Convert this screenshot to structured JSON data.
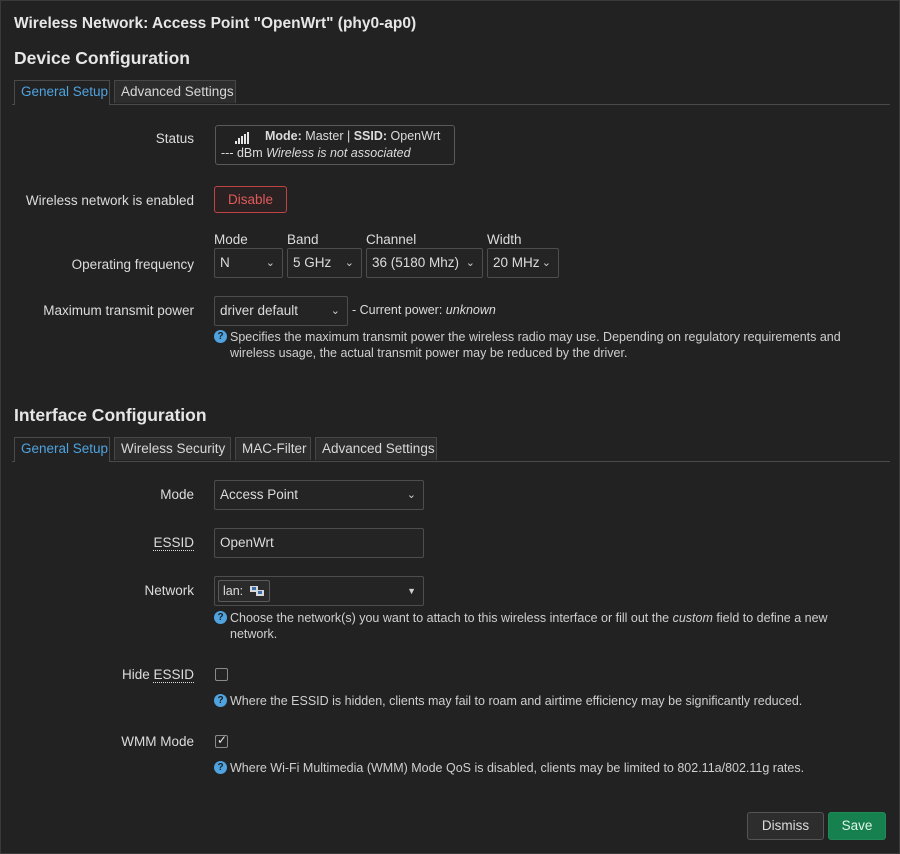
{
  "title": "Wireless Network: Access Point \"OpenWrt\" (phy0-ap0)",
  "device_section": {
    "heading": "Device Configuration",
    "tabs": [
      "General Setup",
      "Advanced Settings"
    ],
    "status_label": "Status",
    "status": {
      "mode_key": "Mode:",
      "mode_value": "Master",
      "separator": "|",
      "ssid_key": "SSID:",
      "ssid_value": "OpenWrt",
      "signal": "--- dBm",
      "association": "Wireless is not associated"
    },
    "enabled_label": "Wireless network is enabled",
    "disable_button": "Disable",
    "frequency_label": "Operating frequency",
    "mode_caption": "Mode",
    "mode_value": "N",
    "band_caption": "Band",
    "band_value": "5 GHz",
    "channel_caption": "Channel",
    "channel_value": "36 (5180 Mhz)",
    "width_caption": "Width",
    "width_value": "20 MHz",
    "txpower_label": "Maximum transmit power",
    "txpower_value": "driver default",
    "current_power_prefix": "- Current power:",
    "current_power_value": "unknown",
    "txpower_help": "Specifies the maximum transmit power the wireless radio may use. Depending on regulatory requirements and wireless usage, the actual transmit power may be reduced by the driver."
  },
  "interface_section": {
    "heading": "Interface Configuration",
    "tabs": [
      "General Setup",
      "Wireless Security",
      "MAC-Filter",
      "Advanced Settings"
    ],
    "mode_label": "Mode",
    "mode_value": "Access Point",
    "essid_label": "ESSID",
    "essid_value": "OpenWrt",
    "network_label": "Network",
    "network_chip": "lan:",
    "network_help_1": "Choose the network(s) you want to attach to this wireless interface or fill out the",
    "network_help_em": "custom",
    "network_help_2": "field to define a new network.",
    "hide_label_pre": "Hide",
    "hide_label_abbr": "ESSID",
    "hide_checked": false,
    "hide_help": "Where the ESSID is hidden, clients may fail to roam and airtime efficiency may be significantly reduced.",
    "wmm_label": "WMM Mode",
    "wmm_checked": true,
    "wmm_help": "Where Wi-Fi Multimedia (WMM) Mode QoS is disabled, clients may be limited to 802.11a/802.11g rates."
  },
  "footer": {
    "dismiss": "Dismiss",
    "save": "Save"
  },
  "icons": {
    "help": "help-icon",
    "signal": "signal-bars-icon",
    "network": "network-ports-icon",
    "chevron": "chevron-down-icon"
  },
  "colors": {
    "accent": "#4fa3df",
    "danger": "#e05a5a",
    "save": "#17804f",
    "background": "#222222"
  }
}
